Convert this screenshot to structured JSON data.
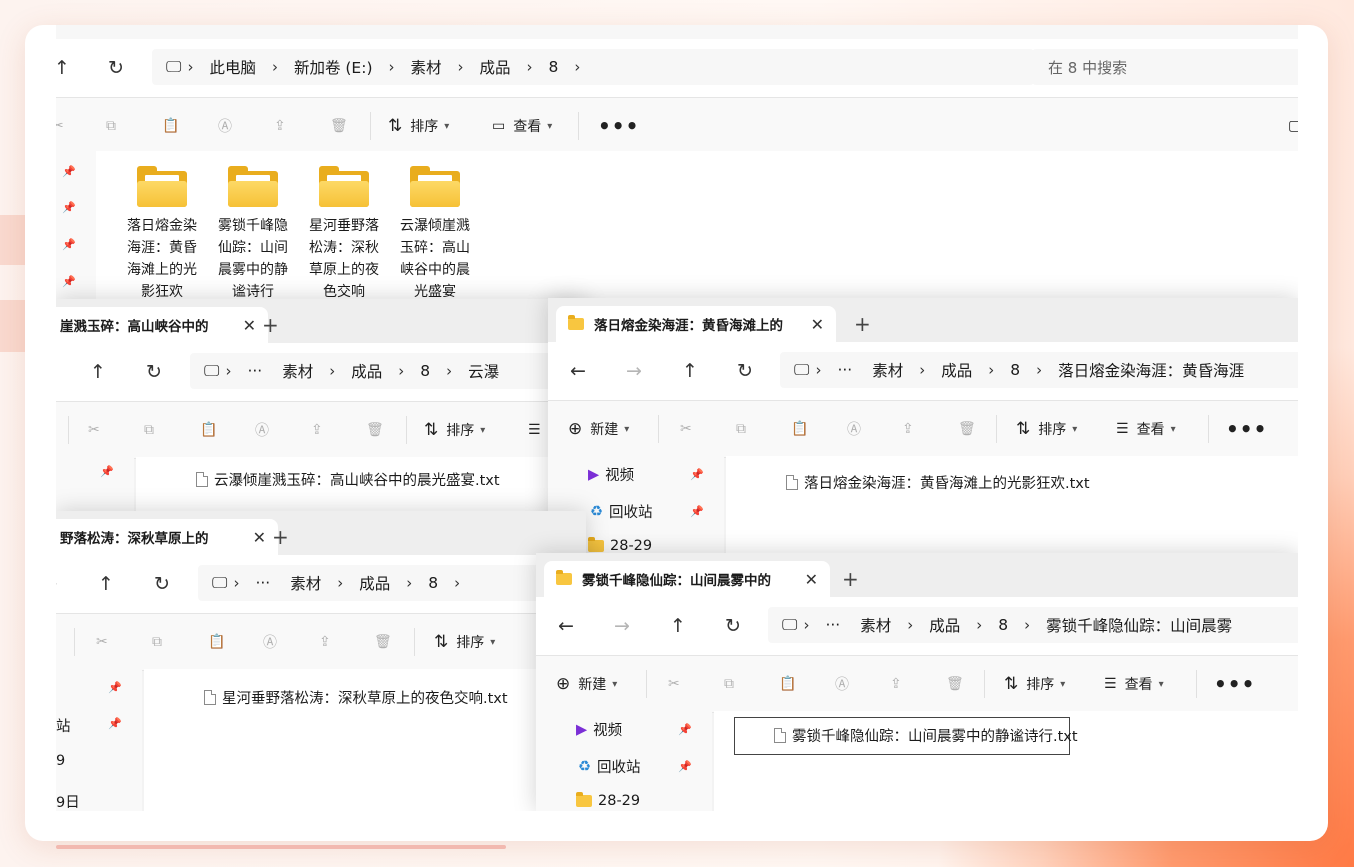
{
  "main_window": {
    "breadcrumb": [
      "此电脑",
      "新加卷 (E:)",
      "素材",
      "成品",
      "8"
    ],
    "search_placeholder": "在 8 中搜索",
    "toolbar": {
      "sort": "排序",
      "view": "查看",
      "more": "•••"
    },
    "folders": [
      {
        "label": "落日熔金染海涯：黄昏海滩上的光影狂欢"
      },
      {
        "label": "雾锁千峰隐仙踪：山间晨雾中的静谧诗行"
      },
      {
        "label": "星河垂野落松涛：深秋草原上的夜色交响"
      },
      {
        "label": "云瀑倾崖溅玉碎：高山峡谷中的晨光盛宴"
      }
    ]
  },
  "window_cloud": {
    "tab_title": "崖溅玉碎：高山峡谷中的",
    "breadcrumb": [
      "···",
      "素材",
      "成品",
      "8",
      "云瀑"
    ],
    "toolbar": {
      "sort": "排序"
    },
    "file": "云瀑倾崖溅玉碎：高山峡谷中的晨光盛宴.txt"
  },
  "window_star": {
    "tab_title": "野落松涛：深秋草原上的",
    "breadcrumb": [
      "···",
      "素材",
      "成品",
      "8"
    ],
    "toolbar": {
      "sort": "排序"
    },
    "nav_items": [
      "站",
      "9",
      "9日"
    ],
    "file": "星河垂野落松涛：深秋草原上的夜色交响.txt"
  },
  "window_sunset": {
    "tab_title": "落日熔金染海涯：黄昏海滩上的",
    "breadcrumb": [
      "···",
      "素材",
      "成品",
      "8",
      "落日熔金染海涯：黄昏海涯"
    ],
    "toolbar": {
      "new": "新建",
      "sort": "排序",
      "view": "查看",
      "more": "•••"
    },
    "nav_items": [
      "视频",
      "回收站",
      "28-29"
    ],
    "file": "落日熔金染海涯：黄昏海滩上的光影狂欢.txt"
  },
  "window_fog": {
    "tab_title": "雾锁千峰隐仙踪：山间晨雾中的",
    "breadcrumb": [
      "···",
      "素材",
      "成品",
      "8",
      "雾锁千峰隐仙踪：山间晨雾"
    ],
    "toolbar": {
      "new": "新建",
      "sort": "排序",
      "view": "查看",
      "more": "•••"
    },
    "nav_items": [
      "视频",
      "回收站",
      "28-29"
    ],
    "file": "雾锁千峰隐仙踪：山间晨雾中的静谧诗行.txt"
  },
  "symbols": {
    "close": "✕",
    "plus": "+",
    "chevron": "›",
    "down": "⌄"
  }
}
